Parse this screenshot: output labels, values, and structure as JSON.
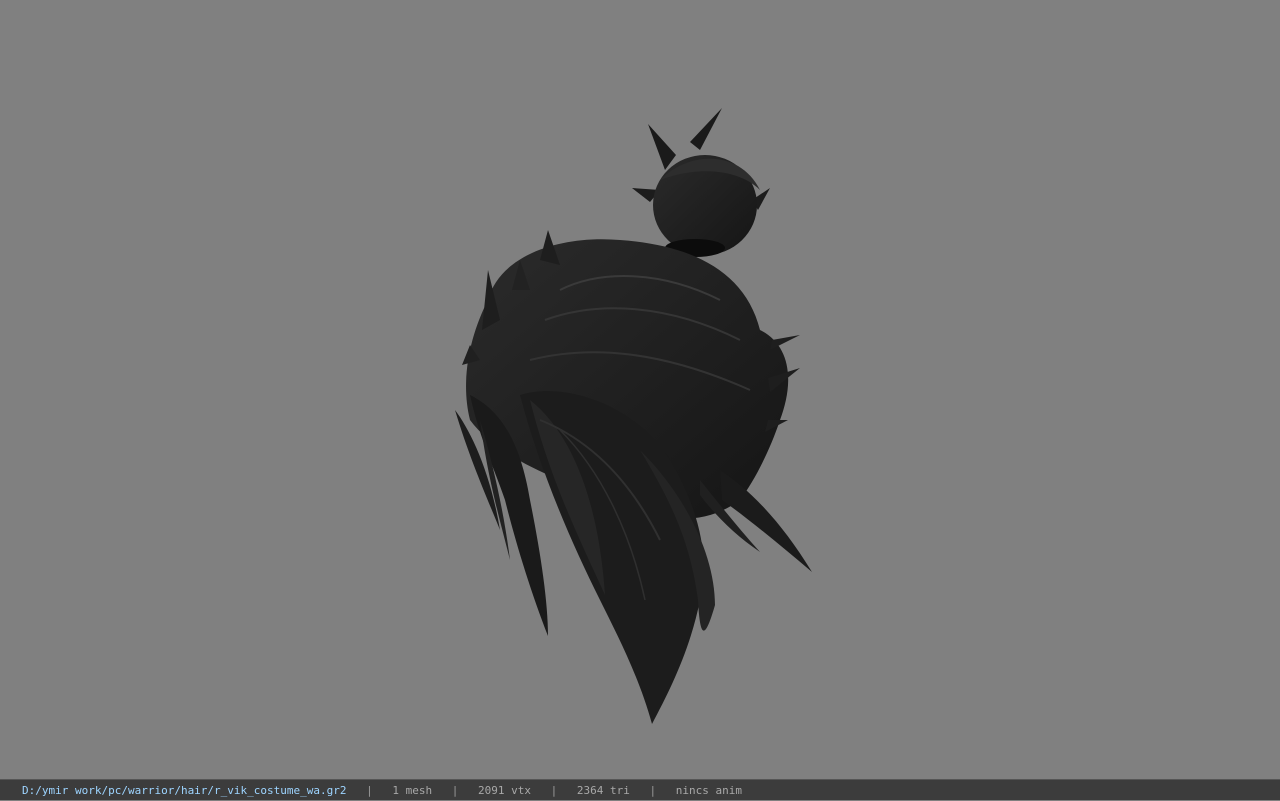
{
  "viewer": {
    "background_color": "#808080",
    "model_icon": "hair-mesh-model",
    "model_color": "#222222"
  },
  "status": {
    "path": "D:/ymir work/pc/warrior/hair/r_vik_costume_wa.gr2",
    "separator": "|",
    "mesh": "1 mesh",
    "vertices": "2091 vtx",
    "triangles": "2364 tri",
    "anim": "nincs anim"
  }
}
